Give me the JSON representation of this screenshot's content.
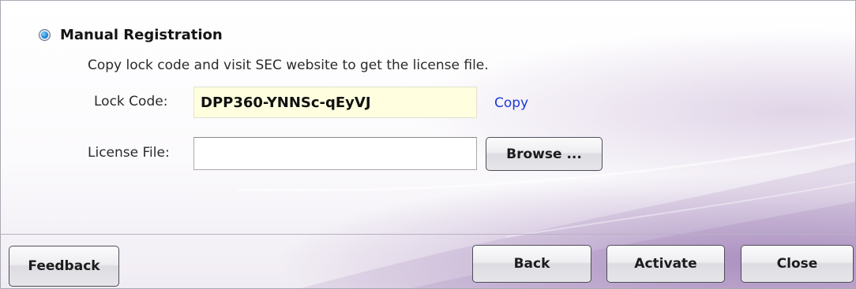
{
  "registration": {
    "option_label": "Manual Registration",
    "selected": true,
    "instruction": "Copy lock code and visit SEC website to get the license file.",
    "lock_code_label": "Lock Code:",
    "lock_code_value": "DPP360-YNNSc-qEyVJ",
    "copy_link": "Copy",
    "license_file_label": "License File:",
    "license_file_value": "",
    "browse_button": "Browse ..."
  },
  "footer": {
    "feedback_button": "Feedback",
    "back_button": "Back",
    "activate_button": "Activate",
    "close_button": "Close"
  },
  "colors": {
    "lock_code_background": "#ffffe0",
    "link": "#1a39d6",
    "radio_selected": "#1e88d8",
    "background_accent": "#8c64aa"
  }
}
